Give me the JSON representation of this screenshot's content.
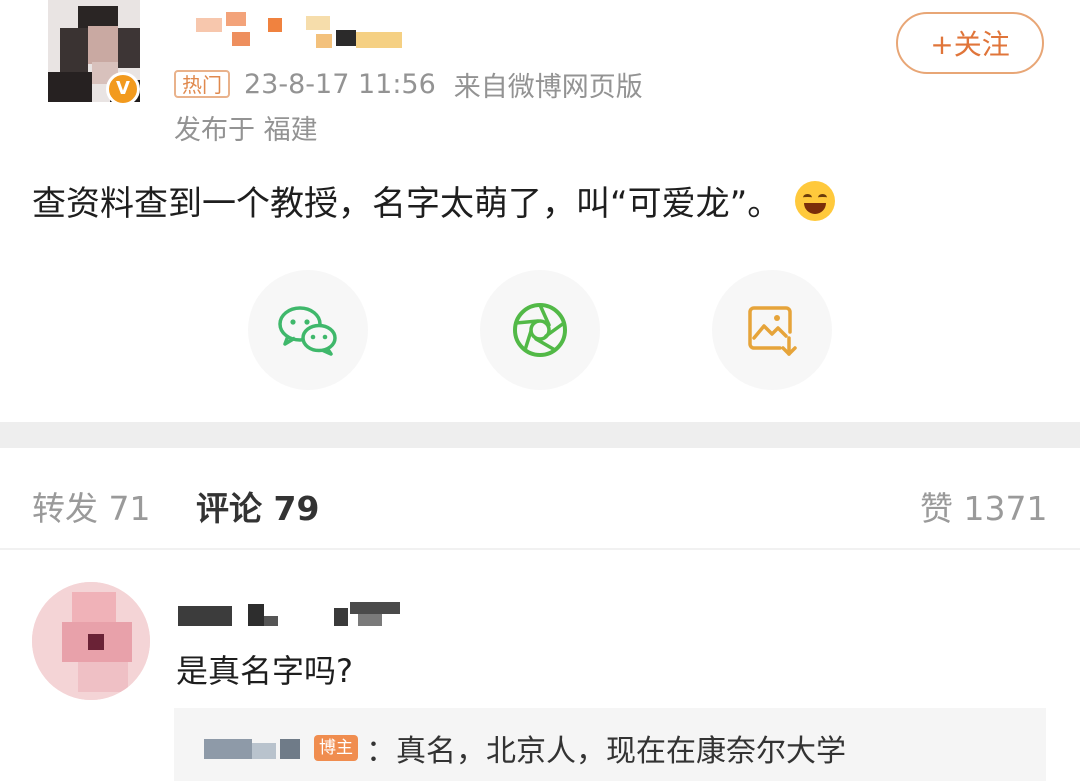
{
  "post": {
    "follow_label": "+关注",
    "verified_badge": "V",
    "hot_tag": "热门",
    "timestamp": "23-8-17 11:56",
    "source": "来自微博网页版",
    "location": "发布于 福建",
    "content": "查资料查到一个教授，名字太萌了，叫“可爱龙”。",
    "emoji": "laugh-cry-emoji"
  },
  "share_actions": [
    {
      "name": "wechat-share",
      "icon": "wechat-icon",
      "color": "#3fb86b"
    },
    {
      "name": "moments-share",
      "icon": "aperture-icon",
      "color": "#52b947"
    },
    {
      "name": "save-image",
      "icon": "image-download-icon",
      "color": "#e6a43a"
    }
  ],
  "tabs": {
    "repost": "转发 71",
    "comments": "评论 79",
    "likes": "赞 1371"
  },
  "comment": {
    "text": "是真名字吗?",
    "reply": {
      "badge": "博主",
      "text": "：真名，北京人，现在在康奈尔大学"
    }
  }
}
